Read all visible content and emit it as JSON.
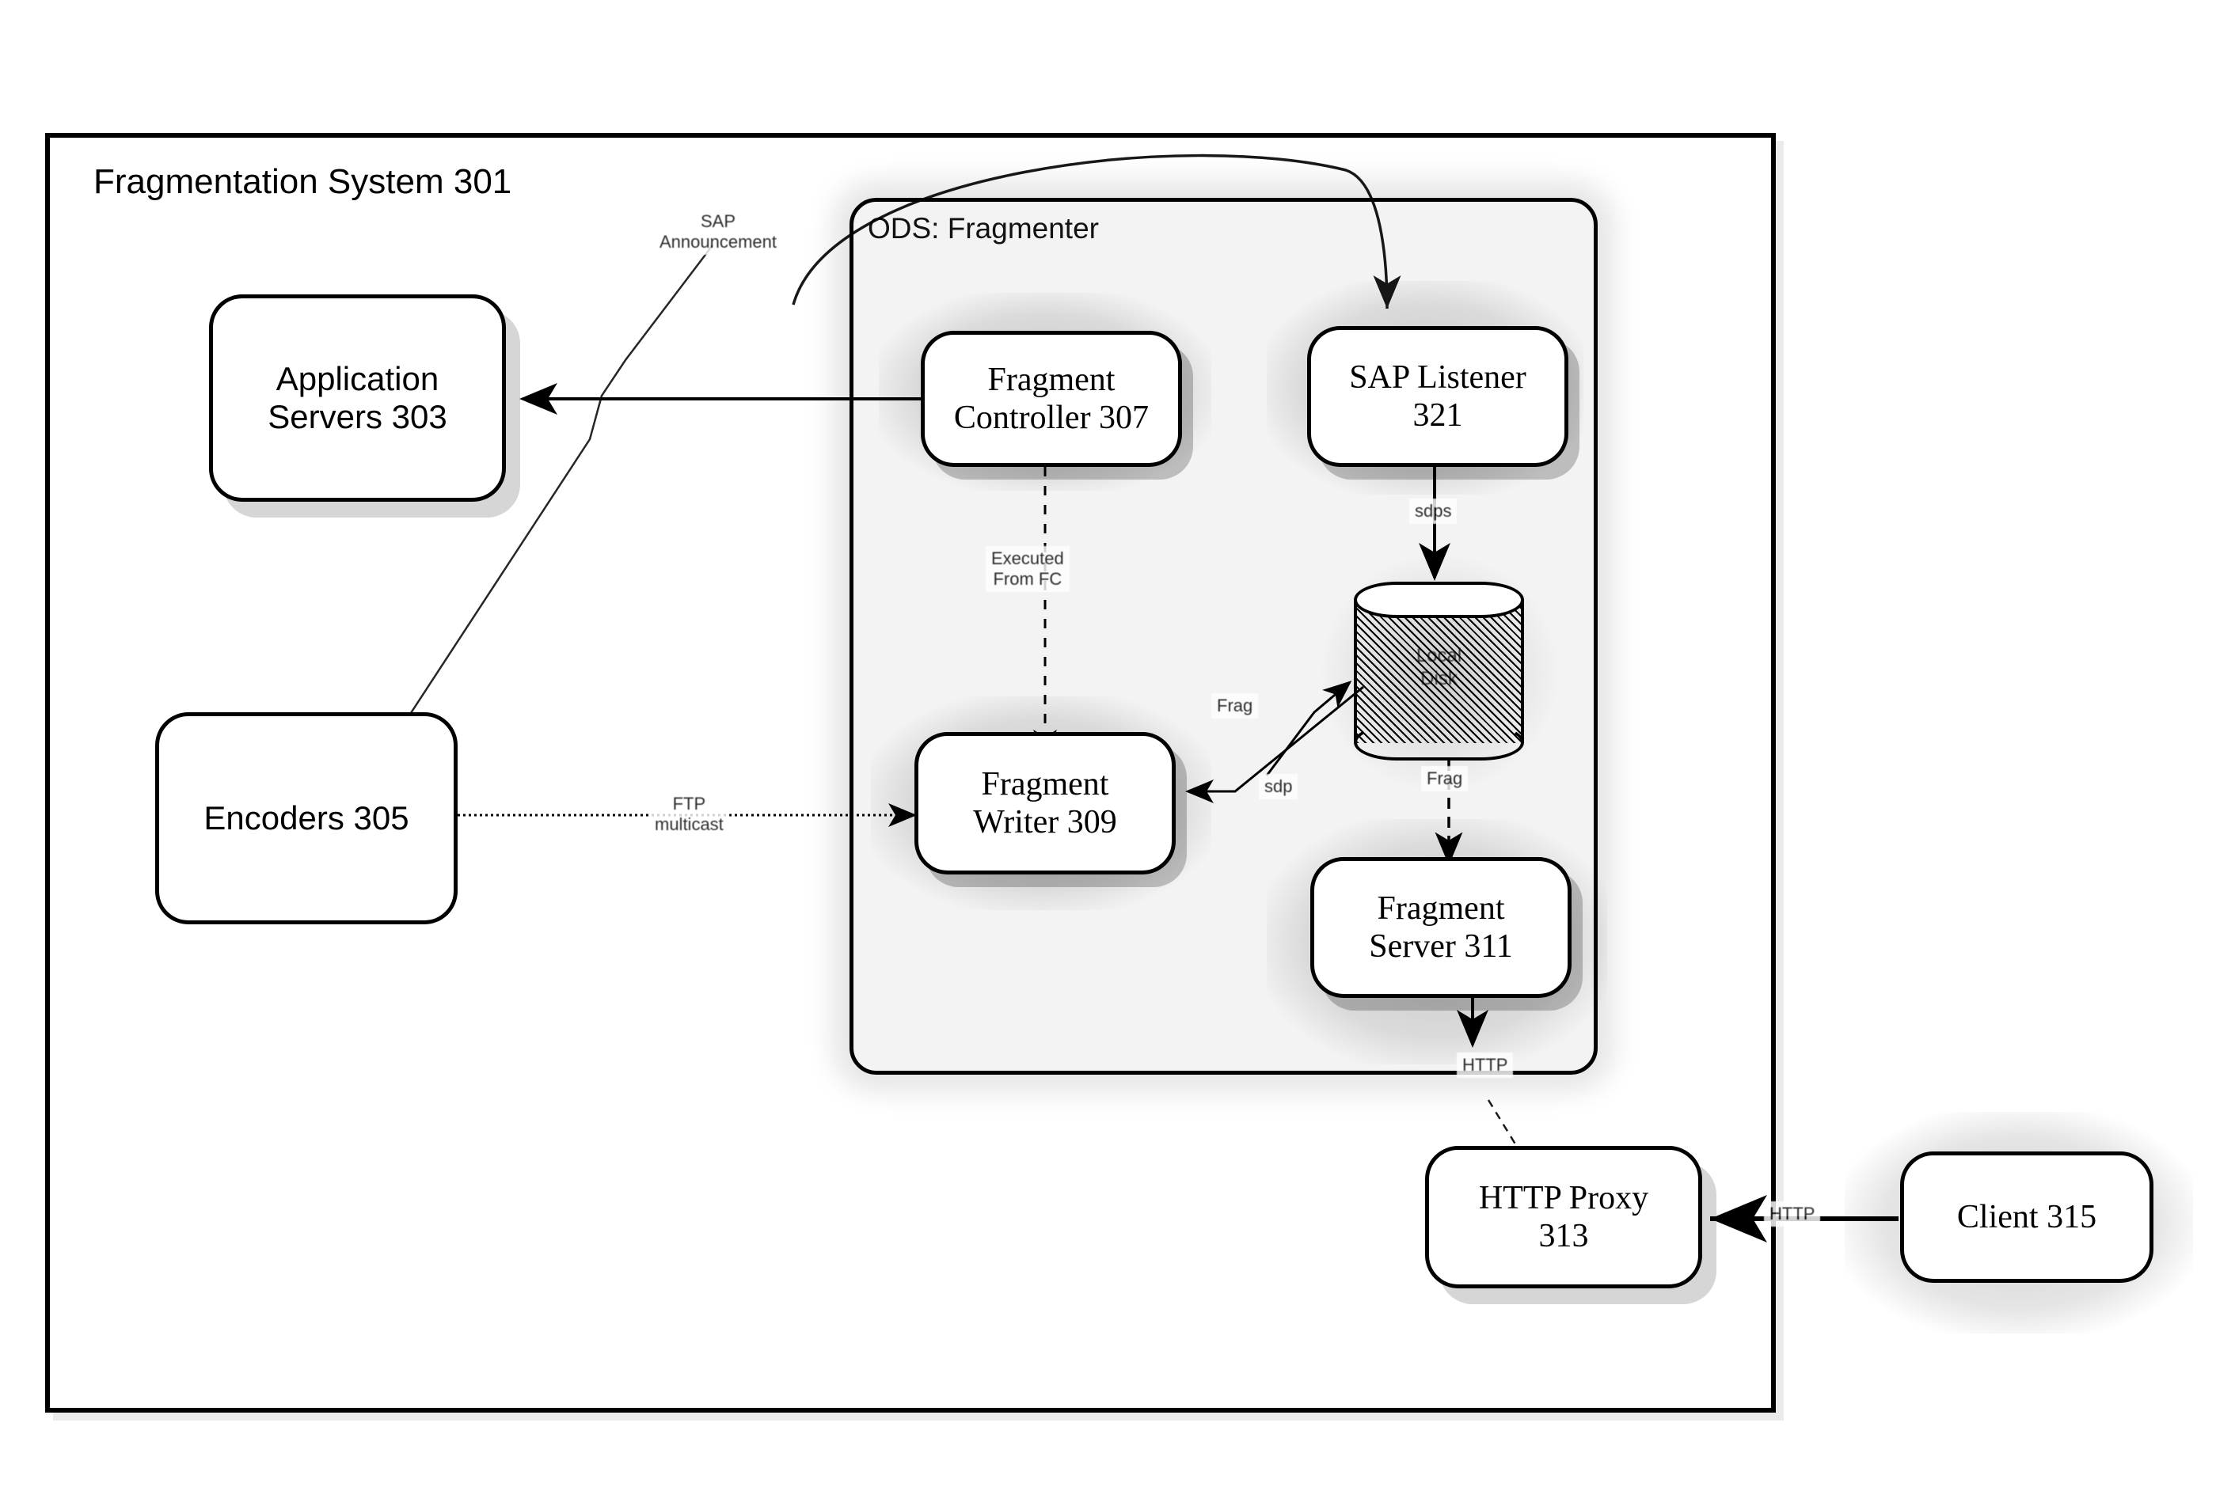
{
  "diagram": {
    "system_title": "Fragmentation System 301",
    "ods_title": "ODS: Fragmenter",
    "nodes": {
      "application_servers": "Application\nServers 303",
      "application_servers_line1": "Application",
      "application_servers_line2": "Servers 303",
      "encoders": "Encoders 305",
      "fragment_controller_line1": "Fragment",
      "fragment_controller_line2": "Controller 307",
      "sap_listener_line1": "SAP Listener",
      "sap_listener_line2": "321",
      "fragment_writer_line1": "Fragment",
      "fragment_writer_line2": "Writer 309",
      "fragment_server_line1": "Fragment",
      "fragment_server_line2": "Server 311",
      "http_proxy_line1": "HTTP Proxy",
      "http_proxy_line2": "313",
      "client": "Client 315",
      "local_disk_line1": "Local",
      "local_disk_line2": "Disk"
    },
    "edge_labels": {
      "sap_announcement_line1": "SAP",
      "sap_announcement_line2": "Announcement",
      "executed_from_fc_line1": "Executed",
      "executed_from_fc_line2": "From FC",
      "ftp_multicast_line1": "FTP",
      "ftp_multicast_line2": "multicast",
      "sdps": "sdps",
      "sdp": "sdp",
      "frag_to_disk": "Frag",
      "frag_to_server": "Frag",
      "http_internal": "HTTP",
      "http_client": "HTTP"
    },
    "colors": {
      "stroke": "#000000",
      "node_fill": "#ffffff",
      "container_fill": "#f3f3f3",
      "page_background": "#ffffff"
    }
  }
}
